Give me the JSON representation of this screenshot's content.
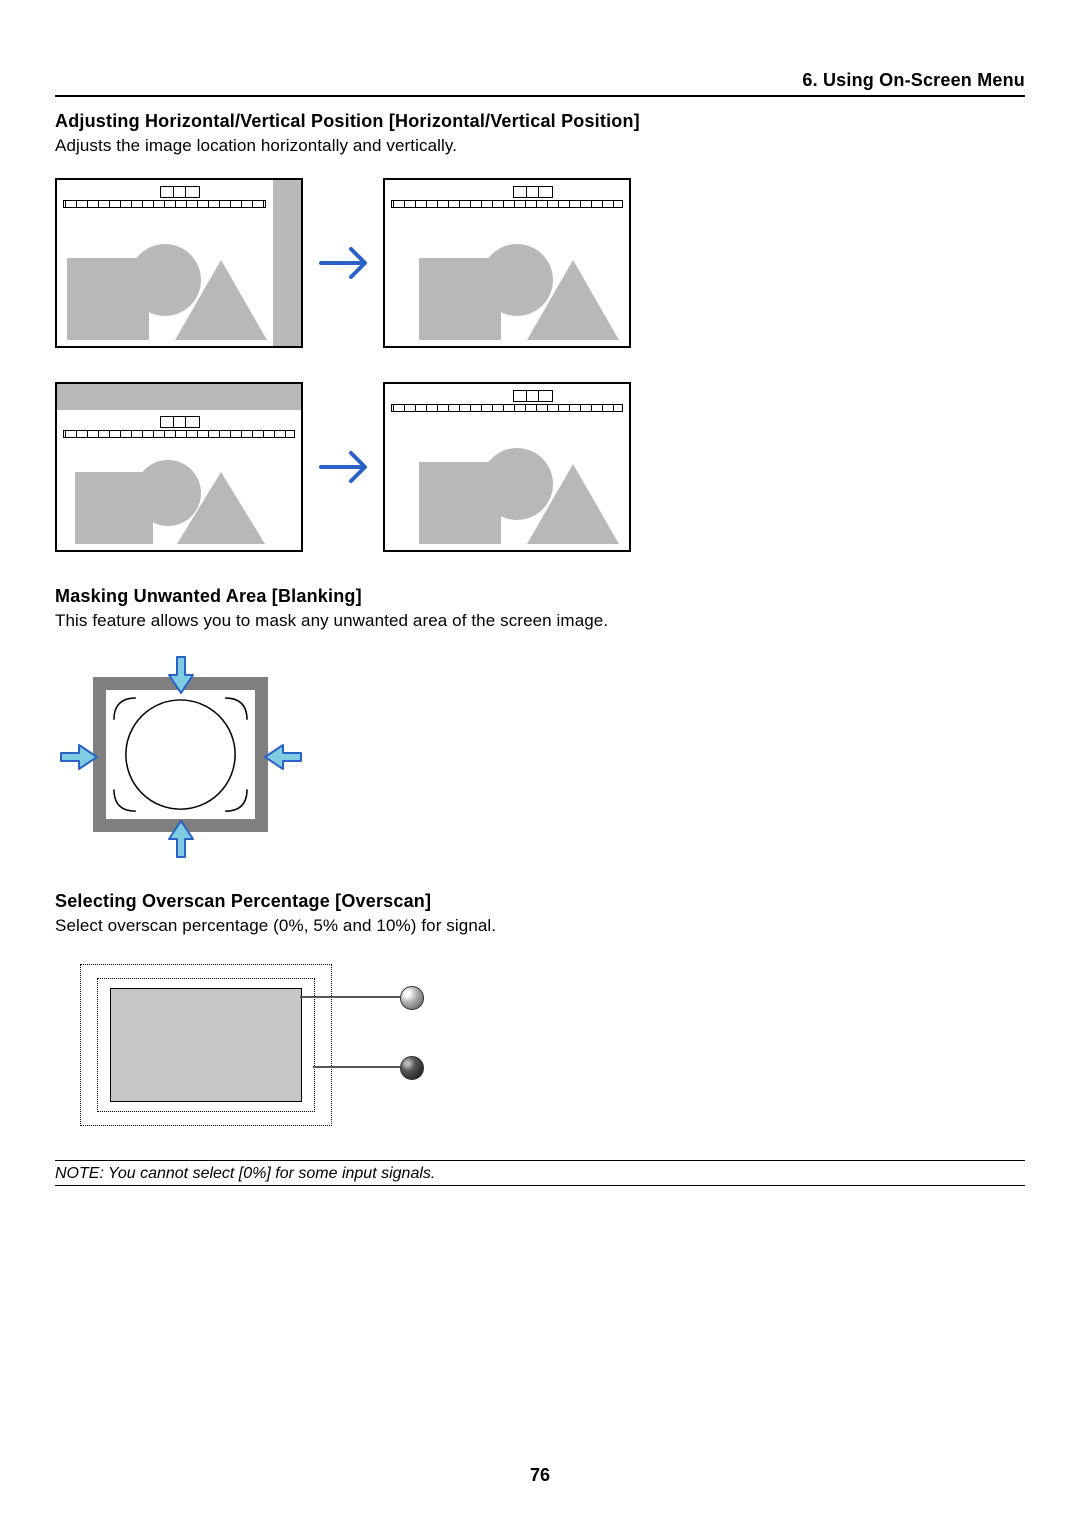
{
  "header": {
    "chapter": "6. Using On-Screen Menu"
  },
  "section1": {
    "title": "Adjusting Horizontal/Vertical Position [Horizontal/Vertical Position]",
    "body": "Adjusts the image location horizontally and vertically."
  },
  "section2": {
    "title": "Masking Unwanted Area [Blanking]",
    "body": "This feature allows you to mask any unwanted area of the screen image."
  },
  "section3": {
    "title": "Selecting Overscan Percentage [Overscan]",
    "body": "Select overscan percentage (0%, 5% and 10%) for signal."
  },
  "note": {
    "text": "NOTE: You cannot select [0%] for some input signals."
  },
  "footer": {
    "page_number": "76"
  },
  "colors": {
    "arrow": "#2a62c8",
    "blanking_arrow_fill": "#7ecde3",
    "blanking_arrow_stroke": "#2a62c8"
  }
}
